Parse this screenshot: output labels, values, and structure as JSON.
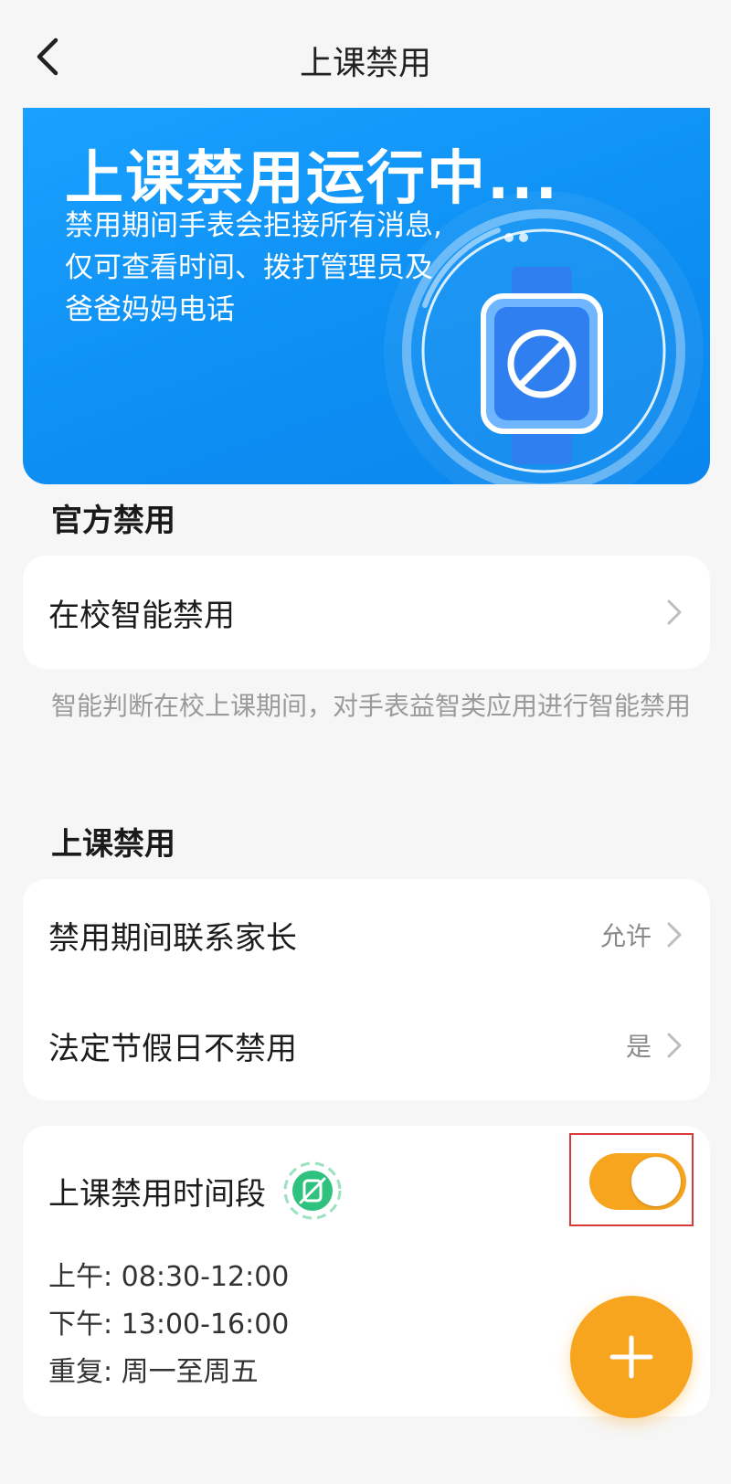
{
  "header": {
    "title": "上课禁用",
    "back_icon": "chevron-left-icon"
  },
  "banner": {
    "title": "上课禁用运行中...",
    "desc_line1": "禁用期间手表会拒接所有消息,",
    "desc_line2": "仅可查看时间、拨打管理员及",
    "desc_line3": "爸爸妈妈电话",
    "icon": "watch-ban-icon",
    "colors": {
      "bg": "#1aa1ff",
      "watch": "#3b82f6"
    }
  },
  "official": {
    "section_title": "官方禁用",
    "smart_ban_label": "在校智能禁用",
    "note": "智能判断在校上课期间，对手表益智类应用进行智能禁用"
  },
  "class_ban": {
    "section_title": "上课禁用",
    "contact_parents_label": "禁用期间联系家长",
    "contact_parents_value": "允许",
    "holiday_label": "法定节假日不禁用",
    "holiday_value": "是"
  },
  "schedule": {
    "title": "上课禁用时间段",
    "badge_icon": "slash-circle-badge-icon",
    "toggle_on": true,
    "morning_label": "上午:",
    "morning_value": "08:30-12:00",
    "afternoon_label": "下午:",
    "afternoon_value": "13:00-16:00",
    "repeat_label": "重复:",
    "repeat_value": "周一至周五"
  },
  "fab": {
    "icon": "plus-icon"
  },
  "colors": {
    "accent": "#f7a51f",
    "highlight": "#d83a3a",
    "badge": "#2ec27e"
  }
}
